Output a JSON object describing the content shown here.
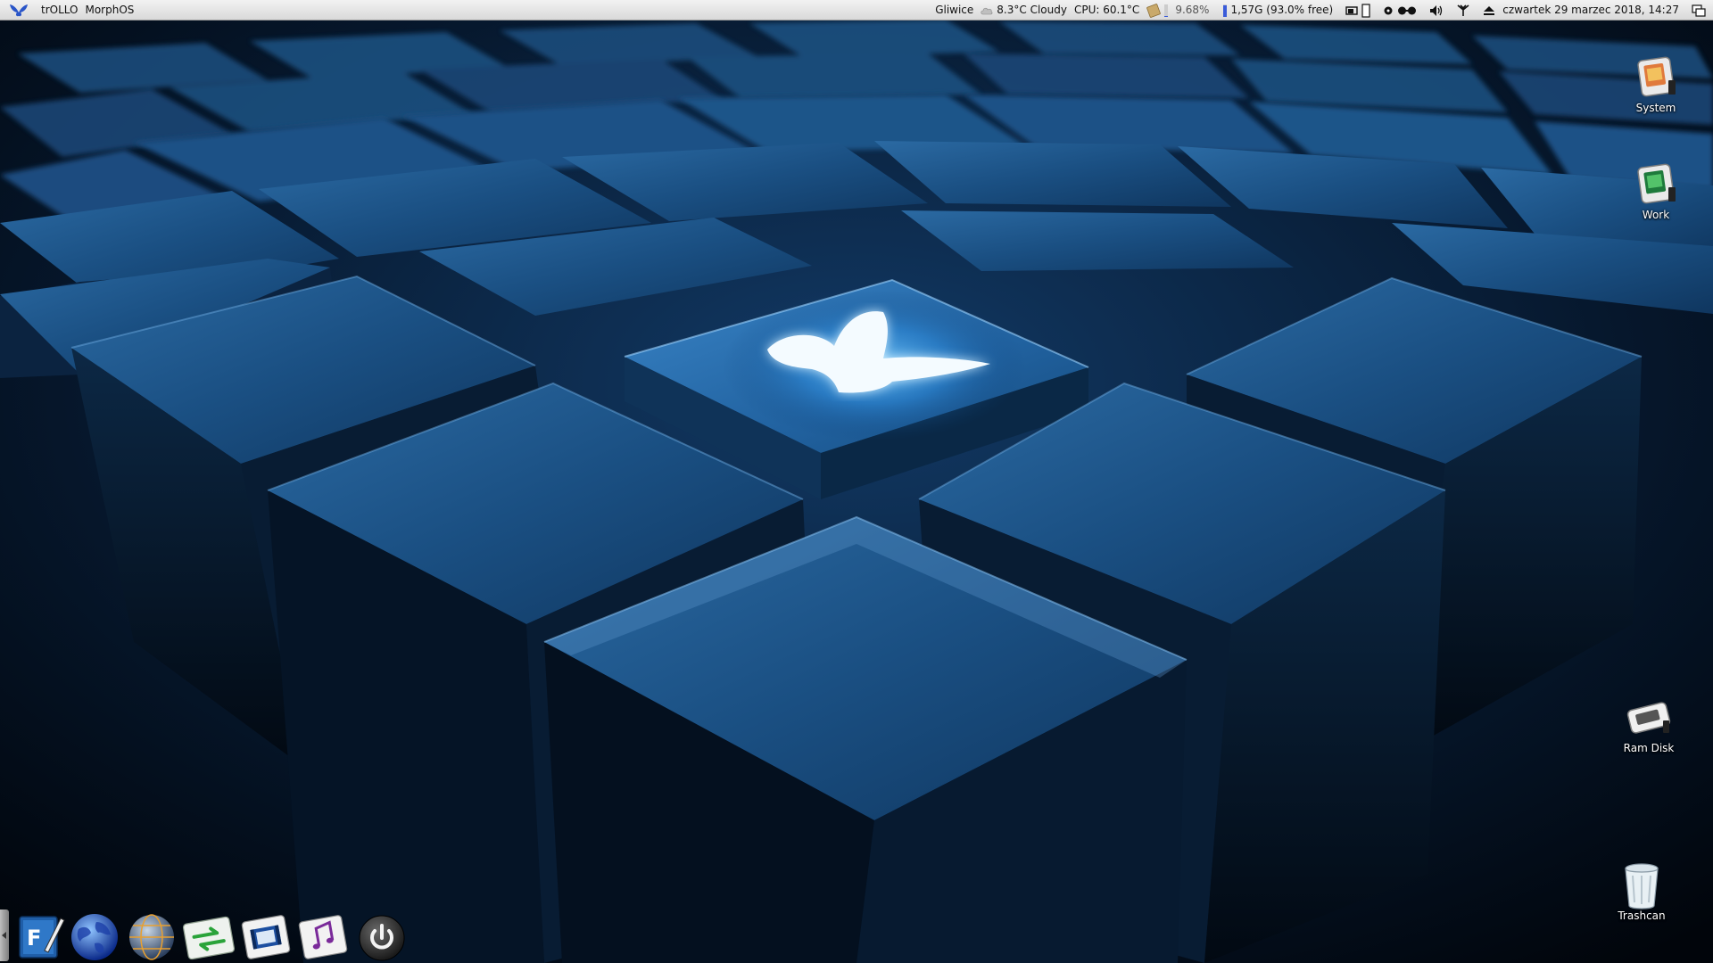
{
  "topbar": {
    "app_name": "trOLLO",
    "screen_title": "MorphOS",
    "weather_city": "Gliwice",
    "weather_text": "8.3°C Cloudy",
    "cpu_temp": "CPU: 60.1°C",
    "cpu_usage": "9.68%",
    "cpu_usage_fraction": 0.0968,
    "memory": "1,57G (93.0% free)",
    "memory_free_fraction": 0.93,
    "datetime": "czwartek 29 marzec 2018, 14:27"
  },
  "desktop_icons": [
    {
      "label": "System",
      "icon": "system-disk-icon"
    },
    {
      "label": "Work",
      "icon": "work-disk-icon"
    },
    {
      "label": "Ram Disk",
      "icon": "ram-disk-icon"
    },
    {
      "label": "Trashcan",
      "icon": "trashcan-icon"
    }
  ],
  "dock": {
    "items": [
      {
        "name": "editor",
        "icon": "text-editor-icon"
      },
      {
        "name": "browser",
        "icon": "globe-icon"
      },
      {
        "name": "network",
        "icon": "network-globe-icon"
      },
      {
        "name": "transfer",
        "icon": "transfer-arrows-icon"
      },
      {
        "name": "video",
        "icon": "film-icon"
      },
      {
        "name": "music",
        "icon": "music-note-icon"
      },
      {
        "name": "shutdown",
        "icon": "power-icon"
      }
    ]
  },
  "colors": {
    "accent": "#3a5bd9",
    "wallpaper_base": "#0b2e55",
    "glow": "#bfe6ff"
  }
}
